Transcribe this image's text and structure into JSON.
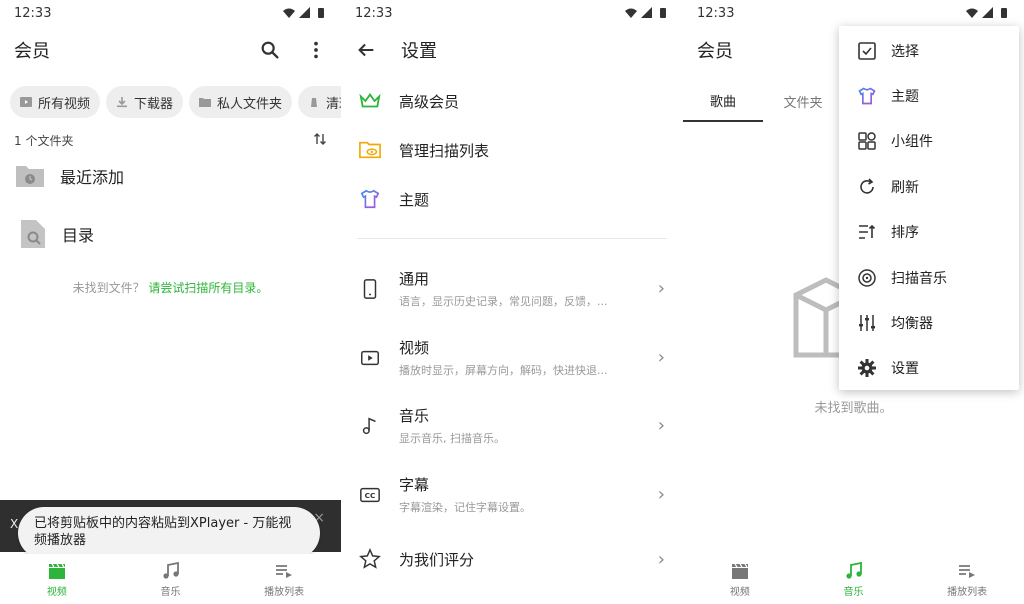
{
  "status": {
    "time": "12:33"
  },
  "colors": {
    "accent": "#2cb53a",
    "crown": "#2cb53a",
    "folder_orange": "#f2a900",
    "shirt_purple": "#b04fd6",
    "shirt_blue": "#3d8df5"
  },
  "panel1": {
    "title": "会员",
    "chips": [
      "所有视频",
      "下载器",
      "私人文件夹",
      "清理"
    ],
    "folder_count": "1 个文件夹",
    "folders": [
      "最近添加",
      "目录"
    ],
    "empty_hint": "未找到文件？",
    "empty_link": "请尝试扫描所有目录。",
    "toast": "已将剪贴板中的内容粘贴到XPlayer - 万能视频播放器",
    "snack_left": "X",
    "snack_close": "×",
    "nav": [
      "视频",
      "音乐",
      "播放列表"
    ]
  },
  "panel2": {
    "title": "设置",
    "top_items": [
      "高级会员",
      "管理扫描列表",
      "主题"
    ],
    "items": [
      {
        "title": "通用",
        "sub": "语言，显示历史记录，常见问题，反馈，..."
      },
      {
        "title": "视频",
        "sub": "播放时显示，屏幕方向，解码，快进快退..."
      },
      {
        "title": "音乐",
        "sub": "显示音乐, 扫描音乐。"
      },
      {
        "title": "字幕",
        "sub": "字幕渲染，记住字幕设置。"
      },
      {
        "title": "为我们评分",
        "sub": ""
      }
    ]
  },
  "panel3": {
    "title": "会员",
    "tabs": [
      "歌曲",
      "文件夹"
    ],
    "empty_text": "未找到歌曲。",
    "menu": [
      "选择",
      "主题",
      "小组件",
      "刷新",
      "排序",
      "扫描音乐",
      "均衡器",
      "设置"
    ],
    "nav": [
      "视频",
      "音乐",
      "播放列表"
    ]
  }
}
